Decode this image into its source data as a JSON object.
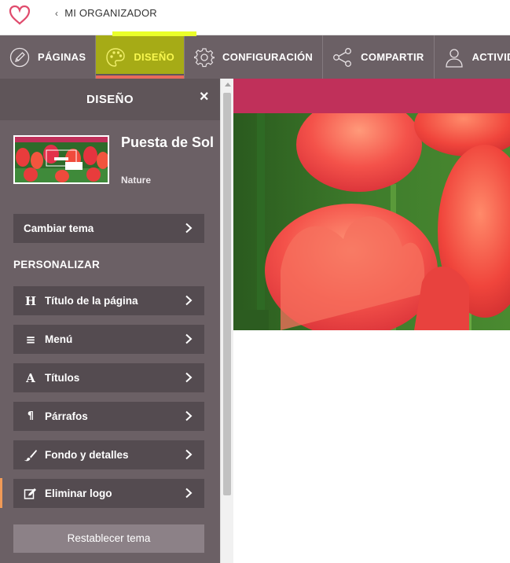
{
  "header": {
    "back_label": "MI ORGANIZADOR",
    "logo_icon": "heart-logo-icon",
    "brand_color": "#e04a6c"
  },
  "nav": {
    "items": [
      {
        "label": "PÁGINAS",
        "icon": "pencil-icon"
      },
      {
        "label": "DISEÑO",
        "icon": "palette-icon",
        "active": true
      },
      {
        "label": "CONFIGURACIÓN",
        "icon": "gear-icon"
      },
      {
        "label": "COMPARTIR",
        "icon": "share-icon"
      },
      {
        "label": "ACTIVID",
        "icon": "person-icon"
      }
    ]
  },
  "sidebar": {
    "title": "DISEÑO",
    "close_symbol": "×",
    "theme": {
      "name": "Puesta de Sol",
      "category": "Nature"
    },
    "change_theme_label": "Cambiar tema",
    "section_title": "PERSONALIZAR",
    "items": [
      {
        "label": "Título de la página",
        "icon_glyph": "H"
      },
      {
        "label": "Menú",
        "icon_glyph": "≡"
      },
      {
        "label": "Títulos",
        "icon_glyph": "A"
      },
      {
        "label": "Párrafos",
        "icon_glyph": "¶"
      },
      {
        "label": "Fondo y detalles",
        "icon_glyph": "brush"
      },
      {
        "label": "Eliminar logo",
        "icon_glyph": "edit"
      }
    ],
    "reset_label": "Restablecer tema"
  },
  "colors": {
    "sidebar_bg": "#6b6065",
    "button_bg": "#544b50",
    "accent_band": "#c0305a",
    "highlight": "#f8f74e"
  }
}
